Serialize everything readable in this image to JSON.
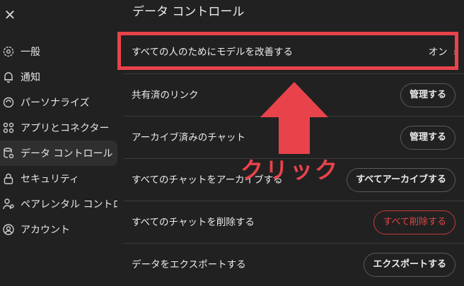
{
  "sidebar": {
    "close_glyph": "✕",
    "items": [
      {
        "label": "一般",
        "icon": "gear-icon"
      },
      {
        "label": "通知",
        "icon": "bell-icon"
      },
      {
        "label": "パーソナライズ",
        "icon": "personalize-icon"
      },
      {
        "label": "アプリとコネクター",
        "icon": "apps-icon"
      },
      {
        "label": "データ コントロール",
        "icon": "database-icon",
        "active": true
      },
      {
        "label": "セキュリティ",
        "icon": "lock-icon"
      },
      {
        "label": "ペアレンタル コントロー...",
        "icon": "parental-icon"
      },
      {
        "label": "アカウント",
        "icon": "account-icon"
      }
    ]
  },
  "main": {
    "title": "データ コントロール",
    "rows": [
      {
        "label": "すべての人のためにモデルを改善する",
        "value": "オン",
        "chevron": "›"
      },
      {
        "label": "共有済のリンク",
        "button": "管理する"
      },
      {
        "label": "アーカイブ済みのチャット",
        "button": "管理する"
      },
      {
        "label": "すべてのチャットをアーカイブする",
        "button": "すべてアーカイブする"
      },
      {
        "label": "すべてのチャットを削除する",
        "button": "すべて削除する"
      },
      {
        "label": "データをエクスポートする",
        "button": "エクスポートする"
      }
    ]
  },
  "annotation": {
    "text": "クリック",
    "color": "#e8434b"
  },
  "colors": {
    "background": "#212121",
    "active_item": "#2f2f2f",
    "danger": "#e04545",
    "highlight": "#e8434b"
  }
}
